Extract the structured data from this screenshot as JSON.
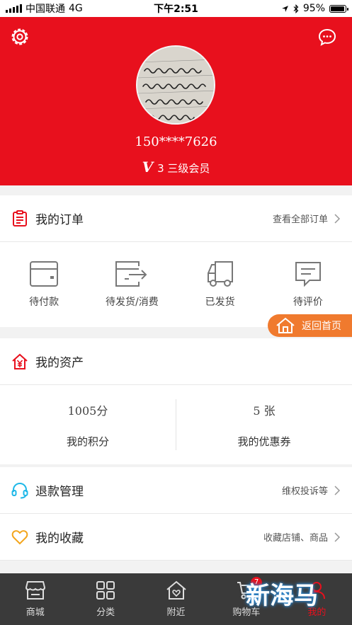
{
  "status": {
    "carrier": "中国联通",
    "network": "4G",
    "time": "下午2:51",
    "battery": "95%",
    "battery_level": 0.95
  },
  "profile": {
    "phone": "150****7626",
    "level_mark": "V",
    "level_text": "3 三级会员"
  },
  "orders": {
    "title": "我的订单",
    "view_all": "查看全部订单",
    "items": [
      {
        "label": "待付款",
        "icon": "wallet-icon"
      },
      {
        "label": "待发货/消费",
        "icon": "pending-ship-icon"
      },
      {
        "label": "已发货",
        "icon": "truck-icon"
      },
      {
        "label": "待评价",
        "icon": "review-icon"
      }
    ]
  },
  "home_button": "返回首页",
  "assets": {
    "title": "我的资产",
    "points_value": "1005分",
    "points_label": "我的积分",
    "coupons_value": "5 张",
    "coupons_label": "我的优惠券"
  },
  "refund": {
    "title": "退款管理",
    "hint": "维权投诉等"
  },
  "favorites": {
    "title": "我的收藏",
    "hint": "收藏店铺、商品"
  },
  "tabs": [
    {
      "label": "商城",
      "icon": "shop-icon"
    },
    {
      "label": "分类",
      "icon": "grid-icon"
    },
    {
      "label": "附近",
      "icon": "nearby-home-icon"
    },
    {
      "label": "购物车",
      "icon": "cart-icon",
      "badge": "7"
    },
    {
      "label": "我的",
      "icon": "user-icon",
      "active": true
    }
  ],
  "watermark": "新海马",
  "colors": {
    "brand_red": "#e8101d",
    "home_button": "#f07a2e",
    "tabbar": "#3a3a3a",
    "refund_icon": "#1fb8e8",
    "favorite_icon": "#f3a51c"
  }
}
